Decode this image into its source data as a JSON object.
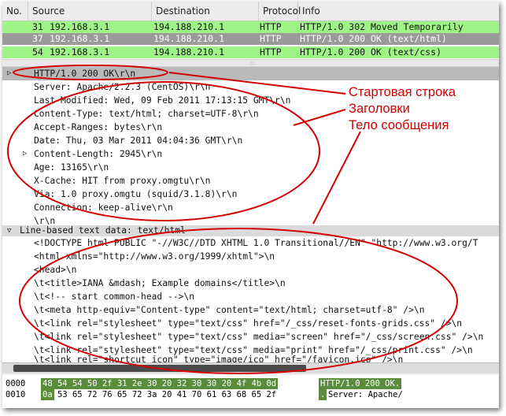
{
  "packet_list": {
    "columns": [
      "No.",
      "Source",
      "Destination",
      "Protocol",
      "Info"
    ],
    "rows": [
      {
        "no": "31",
        "source": "192.168.3.1",
        "destination": "194.188.210.1",
        "protocol": "HTTP",
        "info": "HTTP/1.0 302 Moved Temporarily",
        "style": "green"
      },
      {
        "no": "37",
        "source": "192.168.3.1",
        "destination": "194.188.210.1",
        "protocol": "HTTP",
        "info": "HTTP/1.0 200 OK  (text/html)",
        "style": "selected"
      },
      {
        "no": "54",
        "source": "192.168.3.1",
        "destination": "194.188.210.1",
        "protocol": "HTTP",
        "info": "HTTP/1.0 200 OK  (text/css)",
        "style": "green"
      }
    ]
  },
  "details": {
    "status_line": "HTTP/1.0 200 OK\\r\\n",
    "headers": [
      "Server: Apache/2.2.3 (CentOS)\\r\\n",
      "Last-Modified: Wed, 09 Feb 2011 17:13:15 GMT\\r\\n",
      "Content-Type: text/html; charset=UTF-8\\r\\n",
      "Accept-Ranges: bytes\\r\\n",
      "Date: Thu, 03 Mar 2011 04:04:36 GMT\\r\\n",
      "Content-Length: 2945\\r\\n",
      "Age: 13165\\r\\n",
      "X-Cache: HIT from proxy.omgtu\\r\\n",
      "Via: 1.0 proxy.omgtu (squid/3.1.8)\\r\\n",
      "Connection: keep-alive\\r\\n",
      "\\r\\n"
    ],
    "body_section": "Line-based text data: text/html",
    "body_lines": [
      "<!DOCTYPE html PUBLIC \"-//W3C//DTD XHTML 1.0 Transitional//EN\" \"http://www.w3.org/T",
      "<html xmlns=\"http://www.w3.org/1999/xhtml\">\\n",
      "<head>\\n",
      "\\t<title>IANA &mdash; Example domains</title>\\n",
      "\\t<!-- start common-head -->\\n",
      "\\t<meta http-equiv=\"Content-type\" content=\"text/html; charset=utf-8\" />\\n",
      "\\t<link rel=\"stylesheet\" type=\"text/css\" href=\"/_css/reset-fonts-grids.css\" />\\n",
      "\\t<link rel=\"stylesheet\" type=\"text/css\" media=\"screen\" href=\"/_css/screen.css\" />\\n",
      "\\t<link rel=\"stylesheet\" type=\"text/css\" media=\"print\" href=\"/_css/print.css\" />\\n",
      "\\t<link rel=\"shortcut icon\" type=\"image/ico\" href=\"/favicon.ico\" />\\n"
    ]
  },
  "hex": {
    "rows": [
      {
        "offset": "0000",
        "bytes": "48 54 54 50 2f 31 2e 30  20 32 30 30 20 4f 4b 0d",
        "ascii": "HTTP/1.0  200 OK."
      },
      {
        "offset": "0010",
        "first_byte": "0a",
        "bytes": "53 65 72 76 65 72 3a  20 41 70 61 63 68 65 2f",
        "ascii_sel": ".",
        "ascii": "Server:  Apache/"
      }
    ]
  },
  "annotations": {
    "start_line": "Стартовая строка",
    "headers": "Заголовки",
    "body": "Тело сообщения",
    "color": "#d40000"
  }
}
